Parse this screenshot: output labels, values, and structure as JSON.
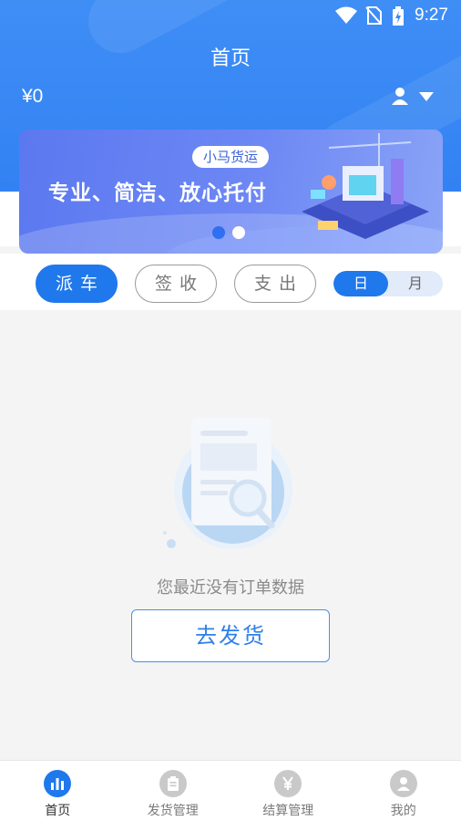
{
  "status_bar": {
    "time": "9:27",
    "icons": [
      "wifi-icon",
      "no-sim-icon",
      "battery-charging-icon"
    ]
  },
  "header": {
    "title": "首页",
    "balance": "¥0",
    "user_icon": "user-icon",
    "dropdown_icon": "caret-down-icon"
  },
  "banner": {
    "tag": "小马货运",
    "slogan": "专业、简洁、放心托付",
    "slide_count": 2,
    "active_slide": 1
  },
  "filters": {
    "tabs": [
      {
        "label": "派车",
        "active": true
      },
      {
        "label": "签收",
        "active": false
      },
      {
        "label": "支出",
        "active": false
      }
    ],
    "period": [
      {
        "label": "日",
        "active": true
      },
      {
        "label": "月",
        "active": false
      }
    ]
  },
  "empty_state": {
    "message": "您最近没有订单数据",
    "button_label": "去发货"
  },
  "tabbar": {
    "items": [
      {
        "label": "首页",
        "icon": "chart-icon",
        "active": true
      },
      {
        "label": "发货管理",
        "icon": "clipboard-icon",
        "active": false
      },
      {
        "label": "结算管理",
        "icon": "yen-icon",
        "active": false
      },
      {
        "label": "我的",
        "icon": "user-icon",
        "active": false
      }
    ]
  },
  "colors": {
    "primary": "#1f78ec",
    "header_bg": "#3a88f4",
    "page_bg": "#f4f4f4"
  }
}
